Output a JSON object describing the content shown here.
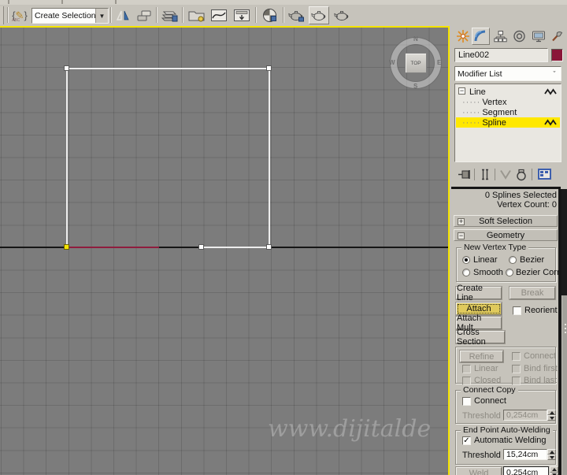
{
  "toolbar": {
    "selection_set_value": "Create Selection Se",
    "icons": [
      "edit-named-selection-sets",
      "mirror",
      "align",
      "layer-manager",
      "scene-explorer",
      "curve-editor",
      "schematic-view",
      "material-editor",
      "render-setup",
      "rendered-frame-window",
      "render-production"
    ]
  },
  "viewport": {
    "viewcube": {
      "face": "TOP",
      "n": "N",
      "e": "E",
      "s": "S",
      "w": "W"
    },
    "watermark": "www.dijitalde"
  },
  "panel": {
    "tabs": [
      "create",
      "modify",
      "hierarchy",
      "motion",
      "display",
      "utilities"
    ],
    "active_tab": "modify",
    "object_name": "Line002",
    "object_color": "#8a1538",
    "modifier_list": "Modifier List",
    "stack": {
      "root": "Line",
      "children": [
        "Vertex",
        "Segment",
        "Spline"
      ],
      "selected": "Spline"
    },
    "stack_tools": [
      "pin-stack",
      "show-end-result",
      "make-unique",
      "remove-modifier",
      "configure-modifier-sets"
    ],
    "status": {
      "line1": "0 Splines Selected",
      "line2": "Vertex Count: 0"
    },
    "rollouts": {
      "soft_selection": "Soft Selection",
      "geometry": "Geometry"
    },
    "new_vertex_type": {
      "title": "New Vertex Type",
      "linear": "Linear",
      "bezier": "Bezier",
      "smooth": "Smooth",
      "bezier_corner": "Bezier Corner",
      "selected": "Linear"
    },
    "geometry_controls": {
      "create_line": "Create Line",
      "break": "Break",
      "attach": "Attach",
      "reorient": "Reorient",
      "attach_mult": "Attach Mult.",
      "cross_section": "Cross Section",
      "refine": "Refine",
      "connect": "Connect",
      "linear": "Linear",
      "bind_first": "Bind first",
      "closed": "Closed",
      "bind_last": "Bind last"
    },
    "connect_copy": {
      "title": "Connect Copy",
      "connect": "Connect",
      "threshold": "Threshold",
      "value": "0,254cm",
      "connect_checked": false
    },
    "end_point_auto_welding": {
      "title": "End Point Auto-Welding",
      "automatic_welding": "Automatic Welding",
      "checked": true,
      "threshold": "Threshold",
      "value": "15,24cm"
    },
    "weld": {
      "label": "Weld",
      "value": "0,254cm"
    }
  },
  "glyphs": {
    "check": "✓"
  }
}
